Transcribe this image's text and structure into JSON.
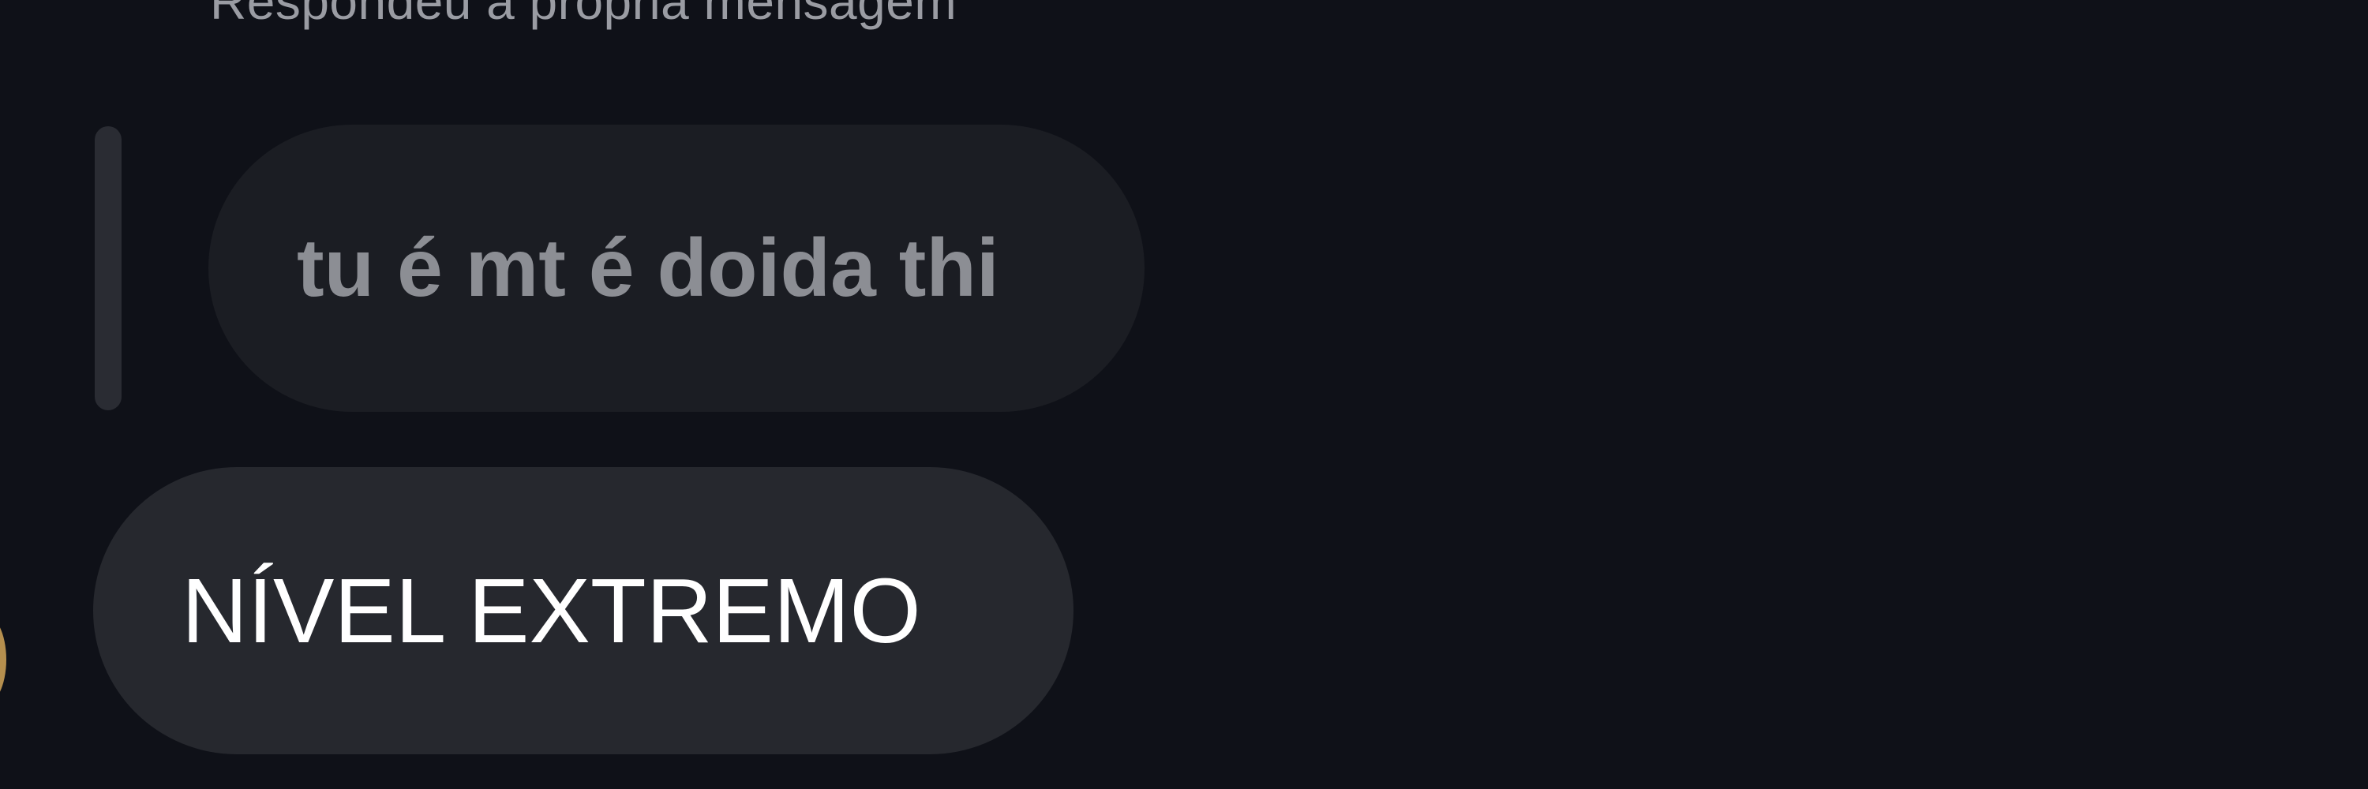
{
  "reply_context": {
    "header": "Respondeu à própria mensagem",
    "quoted_message": "tu é mt é doida thi"
  },
  "message": {
    "text": "NÍVEL EXTREMO"
  }
}
